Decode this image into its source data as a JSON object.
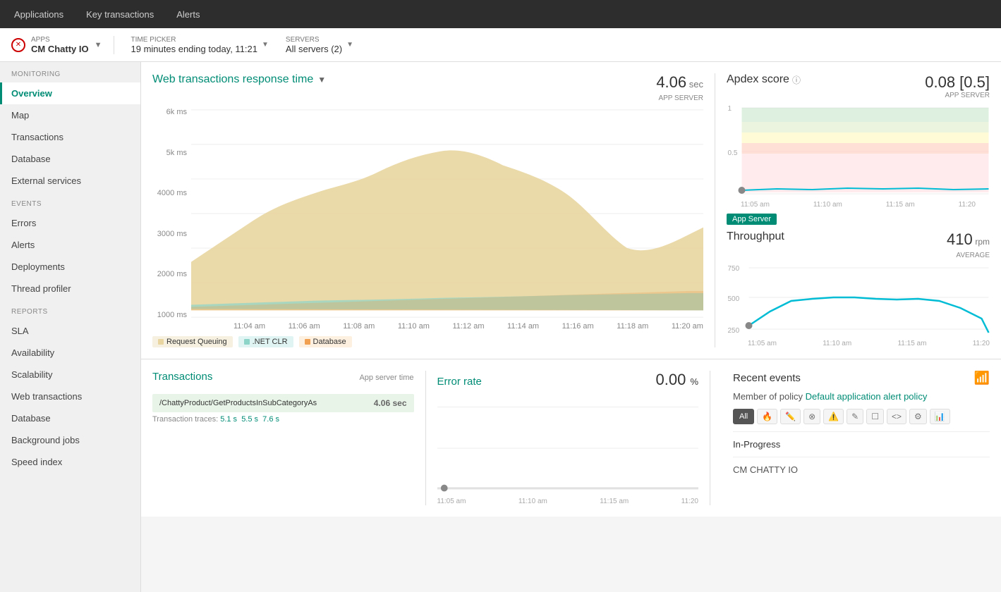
{
  "topNav": {
    "items": [
      "Applications",
      "Key transactions",
      "Alerts"
    ]
  },
  "subHeader": {
    "appsLabel": "APPS",
    "appName": "CM Chatty IO",
    "timePickerLabel": "TIME PICKER",
    "timePickerValue": "19 minutes ending today, 11:21",
    "serversLabel": "SERVERS",
    "serversValue": "All servers (2)"
  },
  "sidebar": {
    "monitoringLabel": "MONITORING",
    "eventsLabel": "EVENTS",
    "reportsLabel": "REPORTS",
    "items": {
      "monitoring": [
        "Overview",
        "Map",
        "Transactions",
        "Database",
        "External services"
      ],
      "events": [
        "Errors",
        "Alerts",
        "Deployments",
        "Thread profiler"
      ],
      "reports": [
        "SLA",
        "Availability",
        "Scalability",
        "Web transactions",
        "Database",
        "Background jobs",
        "Speed index"
      ]
    },
    "activeItem": "Overview"
  },
  "mainChart": {
    "title": "Web transactions response time",
    "stat": {
      "value": "4.06",
      "unit": "sec",
      "label": "APP SERVER"
    },
    "yLabels": [
      "6k ms",
      "5k ms",
      "4000 ms",
      "3000 ms",
      "2000 ms",
      "1000 ms"
    ],
    "xLabels": [
      "11:04 am",
      "11:06 am",
      "11:08 am",
      "11:10 am",
      "11:12 am",
      "11:14 am",
      "11:16 am",
      "11:18 am",
      "11:20 am"
    ],
    "legend": [
      {
        "label": "Request Queuing",
        "color": "#e8d5a0"
      },
      {
        "label": ".NET CLR",
        "color": "#8dd4c8"
      },
      {
        "label": "Database",
        "color": "#f0a050"
      }
    ]
  },
  "apdex": {
    "title": "Apdex score",
    "value": "0.08 [0.5]",
    "label": "APP SERVER",
    "yLabels": [
      "1",
      "0.5"
    ],
    "xLabels": [
      "11:05 am",
      "11:10 am",
      "11:15 am",
      "11:20"
    ],
    "badgeText": "App Server"
  },
  "throughput": {
    "title": "Throughput",
    "value": "410",
    "unit": "rpm",
    "label": "AVERAGE",
    "yLabels": [
      "750",
      "500",
      "250"
    ],
    "xLabels": [
      "11:05 am",
      "11:10 am",
      "11:15 am",
      "11:20"
    ]
  },
  "transactions": {
    "title": "Transactions",
    "subtitle": "App server time",
    "mainTransaction": {
      "name": "/ChattyProduct/GetProductsInSubCategoryAs",
      "time": "4.06 sec"
    },
    "traces": {
      "label": "Transaction traces:",
      "values": [
        "5.1 s",
        "5.5 s",
        "7.6 s"
      ]
    }
  },
  "errorRate": {
    "title": "Error rate",
    "value": "0.00",
    "unit": "%",
    "xLabels": [
      "11:05 am",
      "11:10 am",
      "11:15 am",
      "11:20"
    ]
  },
  "recentEvents": {
    "title": "Recent events",
    "policyText": "Member of policy",
    "policyLink": "Default application alert policy",
    "filterButtons": [
      "All"
    ],
    "filterIcons": [
      "🔥",
      "✏️",
      "⊗",
      "⚠️",
      "✎",
      "☐",
      "<>",
      "⚙",
      "📊"
    ],
    "inProgressLabel": "In-Progress",
    "cmChattyLabel": "CM CHATTY IO"
  }
}
